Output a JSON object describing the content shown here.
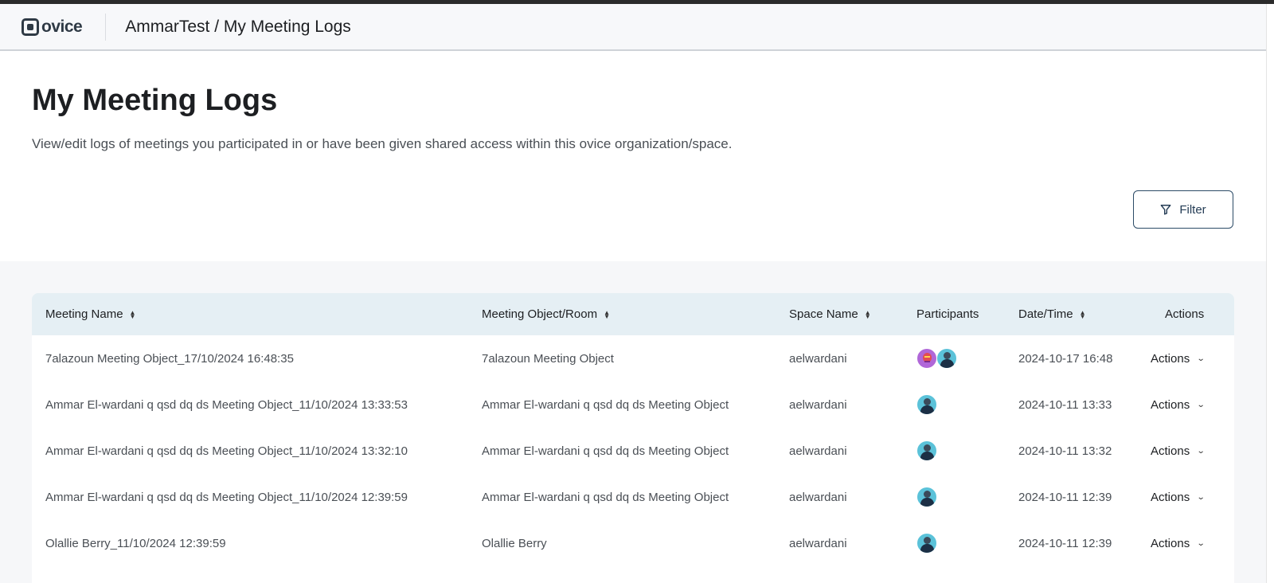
{
  "header": {
    "logo_text": "ovice",
    "breadcrumb": "AmmarTest / My Meeting Logs"
  },
  "page": {
    "title": "My Meeting Logs",
    "description": "View/edit logs of meetings you participated in or have been given shared access within this ovice organization/space.",
    "filter_label": "Filter"
  },
  "table": {
    "columns": [
      "Meeting Name",
      "Meeting Object/Room",
      "Space Name",
      "Participants",
      "Date/Time",
      "Actions"
    ],
    "rows": [
      {
        "name": "7alazoun Meeting Object_17/10/2024 16:48:35",
        "room": "7alazoun Meeting Object",
        "space": "aelwardani",
        "participants": [
          "alien-avatar",
          "person-avatar"
        ],
        "datetime": "2024-10-17 16:48",
        "action": "Actions"
      },
      {
        "name": "Ammar El-wardani q qsd dq ds Meeting Object_11/10/2024 13:33:53",
        "room": "Ammar El-wardani q qsd dq ds Meeting Object",
        "space": "aelwardani",
        "participants": [
          "person-avatar"
        ],
        "datetime": "2024-10-11 13:33",
        "action": "Actions"
      },
      {
        "name": "Ammar El-wardani q qsd dq ds Meeting Object_11/10/2024 13:32:10",
        "room": "Ammar El-wardani q qsd dq ds Meeting Object",
        "space": "aelwardani",
        "participants": [
          "person-avatar"
        ],
        "datetime": "2024-10-11 13:32",
        "action": "Actions"
      },
      {
        "name": "Ammar El-wardani q qsd dq ds Meeting Object_11/10/2024 12:39:59",
        "room": "Ammar El-wardani q qsd dq ds Meeting Object",
        "space": "aelwardani",
        "participants": [
          "person-avatar"
        ],
        "datetime": "2024-10-11 12:39",
        "action": "Actions"
      },
      {
        "name": "Olallie Berry_11/10/2024 12:39:59",
        "room": "Olallie Berry",
        "space": "aelwardani",
        "participants": [
          "person-avatar"
        ],
        "datetime": "2024-10-11 12:39",
        "action": "Actions"
      }
    ]
  },
  "colors": {
    "header_bg": "#f7f8fa",
    "table_header_bg": "#e5eff4",
    "accent": "#2c4b66"
  }
}
